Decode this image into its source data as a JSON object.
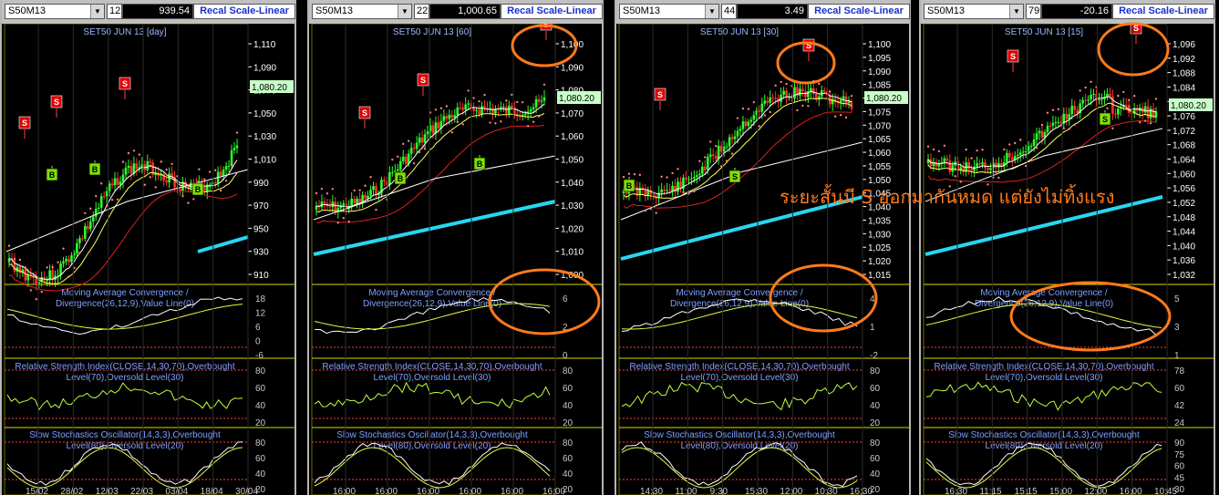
{
  "panels": [
    {
      "symbol": "S50M13",
      "num": "12",
      "price": "939.54",
      "recal": "Recal Scale-Linear",
      "title": "SET50 JUN 13   [day]",
      "last_price": "1,080.20",
      "price_axis": [
        "1,110",
        "1,090",
        "1,070",
        "1,050",
        "1,030",
        "1,010",
        "990",
        "970",
        "950",
        "930",
        "910"
      ],
      "macd_axis": [
        "18",
        "12",
        "6",
        "0",
        "-6"
      ],
      "rsi_axis": [
        "80",
        "60",
        "40",
        "20"
      ],
      "sto_axis": [
        "80",
        "60",
        "40",
        "20"
      ],
      "time_axis": [
        "15/02",
        "28/02",
        "12/03",
        "22/03",
        "03/04",
        "18/04",
        "30/04"
      ],
      "signals": [
        {
          "type": "S",
          "label": "S"
        },
        {
          "type": "S",
          "label": "S"
        },
        {
          "type": "S",
          "label": "S"
        },
        {
          "type": "B",
          "label": "B"
        },
        {
          "type": "B",
          "label": "B"
        },
        {
          "type": "B",
          "label": "B"
        }
      ]
    },
    {
      "symbol": "S50M13",
      "num": "22",
      "price": "1,000.65",
      "recal": "Recal Scale-Linear",
      "title": "SET50 JUN 13   [60]",
      "last_price": "1,080.20",
      "price_axis": [
        "1,100",
        "1,090",
        "1,080",
        "1,070",
        "1,060",
        "1,050",
        "1,040",
        "1,030",
        "1,020",
        "1,010",
        "1,000"
      ],
      "macd_axis": [
        "6",
        "2",
        "0"
      ],
      "rsi_axis": [
        "80",
        "60",
        "40",
        "20"
      ],
      "sto_axis": [
        "80",
        "60",
        "40",
        "20"
      ],
      "time_axis": [
        "16:00",
        "16:00",
        "16:00",
        "16:00",
        "16:00",
        "16:00"
      ],
      "signals": [
        {
          "type": "S",
          "label": "S"
        },
        {
          "type": "S",
          "label": "S"
        },
        {
          "type": "S",
          "label": "S"
        },
        {
          "type": "B",
          "label": "B"
        },
        {
          "type": "B",
          "label": "B"
        }
      ]
    },
    {
      "symbol": "S50M13",
      "num": "44",
      "price": "3.49",
      "recal": "Recal Scale-Linear",
      "title": "SET50 JUN 13   [30]",
      "last_price": "1,080.20",
      "price_axis": [
        "1,100",
        "1,095",
        "1,090",
        "1,085",
        "1,080",
        "1,075",
        "1,070",
        "1,065",
        "1,060",
        "1,055",
        "1,050",
        "1,045",
        "1,040",
        "1,035",
        "1,030",
        "1,025",
        "1,020",
        "1,015"
      ],
      "macd_axis": [
        "4",
        "1",
        "-2"
      ],
      "rsi_axis": [
        "80",
        "60",
        "40",
        "20"
      ],
      "sto_axis": [
        "80",
        "60",
        "40",
        "20"
      ],
      "time_axis": [
        "14:30",
        "11:00",
        "9:30",
        "15:30",
        "12:00",
        "10:30",
        "16:30"
      ],
      "signals": [
        {
          "type": "S",
          "label": "S"
        },
        {
          "type": "S",
          "label": "S"
        },
        {
          "type": "S",
          "label": "S"
        },
        {
          "type": "B",
          "label": "B"
        },
        {
          "type": "B",
          "label": "B"
        }
      ]
    },
    {
      "symbol": "S50M13",
      "num": "79",
      "price": "-20.16",
      "recal": "Recal Scale-Linear",
      "title": "SET50 JUN 13   [15]",
      "last_price": "1,080.20",
      "price_axis": [
        "1,096",
        "1,092",
        "1,088",
        "1,084",
        "1,080",
        "1,076",
        "1,072",
        "1,068",
        "1,064",
        "1,060",
        "1,056",
        "1,052",
        "1,048",
        "1,044",
        "1,040",
        "1,036",
        "1,032"
      ],
      "macd_axis": [
        "5",
        "3",
        "1"
      ],
      "rsi_axis": [
        "78",
        "60",
        "42",
        "24"
      ],
      "sto_axis": [
        "90",
        "75",
        "60",
        "45",
        "30"
      ],
      "time_axis": [
        "16:30",
        "11:15",
        "15:15",
        "15:00",
        "12:00",
        "16:00",
        "10:45"
      ],
      "signals": [
        {
          "type": "S",
          "label": "S"
        },
        {
          "type": "S",
          "label": "S"
        },
        {
          "type": "S",
          "label": "S"
        },
        {
          "type": "B",
          "label": "B"
        }
      ]
    }
  ],
  "indicators": {
    "macd": [
      "Moving Average Convergence /",
      "Divergence(26,12,9),Value Line(0)"
    ],
    "rsi": [
      "Relative Strength Index(CLOSE,14,30,70),Overbought",
      "Level(70),Oversold Level(30)"
    ],
    "sto": [
      "Slow Stochastics Oscillator(14,3,3),Overbought",
      "Level(80),Oversold Level(20)"
    ],
    "sto4": [
      "Slow Stochastics Oscillator(14,3,3),Overbought",
      "Level(80),Oversold Level(20)"
    ]
  },
  "overlay_text": "ระยะสั้นมี S ออกมากันหมด แต่ยังไม่ทิ้งแรง",
  "colors": {
    "sell": "#e00000",
    "buy": "#7fe000",
    "sar": "#ff8080",
    "highlight": "#ff7a1a",
    "price_label_bg": "#c8ffc8",
    "cyan": "#27d7f0"
  }
}
